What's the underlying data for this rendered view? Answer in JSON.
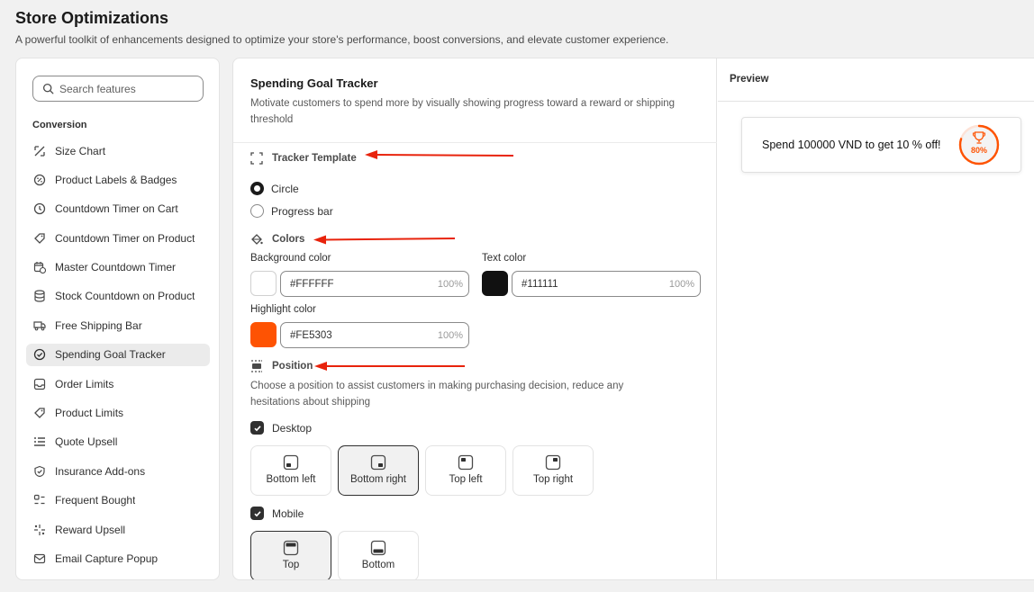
{
  "page": {
    "title": "Store Optimizations",
    "subtitle": "A powerful toolkit of enhancements designed to optimize your store's performance, boost conversions, and elevate customer experience."
  },
  "sidebar": {
    "search_placeholder": "Search features",
    "section_label": "Conversion",
    "items": [
      {
        "label": "Size Chart",
        "icon": "size-chart-icon"
      },
      {
        "label": "Product Labels & Badges",
        "icon": "badge-icon"
      },
      {
        "label": "Countdown Timer on Cart",
        "icon": "clock-icon"
      },
      {
        "label": "Countdown Timer on Product",
        "icon": "tag-clock-icon"
      },
      {
        "label": "Master Countdown Timer",
        "icon": "calendar-clock-icon"
      },
      {
        "label": "Stock Countdown on Product",
        "icon": "database-icon"
      },
      {
        "label": "Free Shipping Bar",
        "icon": "truck-icon"
      },
      {
        "label": "Spending Goal Tracker",
        "icon": "check-circle-icon",
        "active": true
      },
      {
        "label": "Order Limits",
        "icon": "inbox-icon"
      },
      {
        "label": "Product Limits",
        "icon": "tag-icon"
      },
      {
        "label": "Quote Upsell",
        "icon": "list-icon"
      },
      {
        "label": "Insurance Add-ons",
        "icon": "shield-icon"
      },
      {
        "label": "Frequent Bought",
        "icon": "bundle-icon"
      },
      {
        "label": "Reward Upsell",
        "icon": "sparkle-icon"
      },
      {
        "label": "Email Capture Popup",
        "icon": "mail-icon"
      }
    ]
  },
  "settings": {
    "title": "Spending Goal Tracker",
    "description": "Motivate customers to spend more by visually showing progress toward a reward or shipping threshold",
    "tracker_template": {
      "heading": "Tracker Template",
      "options": [
        {
          "label": "Circle",
          "selected": true
        },
        {
          "label": "Progress bar",
          "selected": false
        }
      ]
    },
    "colors": {
      "heading": "Colors",
      "background": {
        "label": "Background color",
        "hex": "#FFFFFF",
        "opacity": "100%"
      },
      "text": {
        "label": "Text color",
        "hex": "#111111",
        "opacity": "100%"
      },
      "highlight": {
        "label": "Highlight color",
        "hex": "#FE5303",
        "opacity": "100%"
      }
    },
    "position": {
      "heading": "Position",
      "description": "Choose a position to assist customers in making purchasing decision, reduce any hesitations about shipping",
      "desktop": {
        "label": "Desktop",
        "checked": true,
        "options": [
          "Bottom left",
          "Bottom right",
          "Top left",
          "Top right"
        ],
        "selected": "Bottom right"
      },
      "mobile": {
        "label": "Mobile",
        "checked": true,
        "options": [
          "Top",
          "Bottom"
        ],
        "selected": "Top"
      }
    }
  },
  "preview": {
    "title": "Preview",
    "message": "Spend 100000 VND to get 10 % off!",
    "progress": 80,
    "progress_label": "80%"
  },
  "colors": {
    "accent": "#FE5303",
    "annotation_arrow": "#E8230C",
    "text_primary": "#303030"
  }
}
